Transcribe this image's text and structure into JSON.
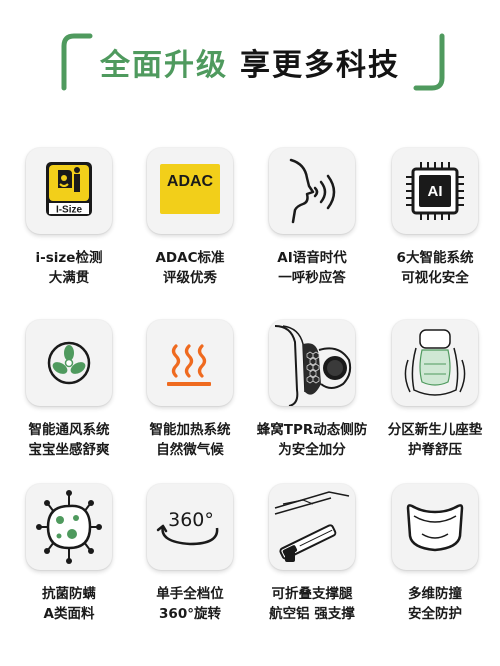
{
  "header": {
    "title_green": "全面升级",
    "title_dark": "享更多科技"
  },
  "colors": {
    "accent_green": "#4f9a5e",
    "badge_yellow": "#f2cf1a",
    "heat_orange": "#ef6a1f",
    "tile_bg": "#f3f3f3"
  },
  "features": [
    {
      "icon": "isize-badge-icon",
      "badge_text": "I-Size",
      "line1": "i-size检测",
      "line2": "大满贯"
    },
    {
      "icon": "adac-badge-icon",
      "badge_text": "ADAC",
      "line1": "ADAC标准",
      "line2": "评级优秀"
    },
    {
      "icon": "voice-head-icon",
      "line1": "AI语音时代",
      "line2": "一呼秒应答"
    },
    {
      "icon": "ai-chip-icon",
      "badge_text": "AI",
      "line1": "6大智能系统",
      "line2": "可视化安全"
    },
    {
      "icon": "fan-icon",
      "line1": "智能通风系统",
      "line2": "宝宝坐感舒爽"
    },
    {
      "icon": "heat-waves-icon",
      "line1": "智能加热系统",
      "line2": "自然微气候"
    },
    {
      "icon": "honeycomb-side-icon",
      "line1": "蜂窝TPR动态侧防",
      "line2": "为安全加分"
    },
    {
      "icon": "newborn-seat-icon",
      "line1": "分区新生儿座垫",
      "line2": "护脊舒压"
    },
    {
      "icon": "germ-icon",
      "line1": "抗菌防螨",
      "line2": "A类面料"
    },
    {
      "icon": "rotate-360-icon",
      "badge_text": "360°",
      "line1": "单手全档位",
      "line2": "360°旋转"
    },
    {
      "icon": "support-leg-icon",
      "line1": "可折叠支撑腿",
      "line2": "航空铝 强支撑"
    },
    {
      "icon": "impact-shield-icon",
      "line1": "多维防撞",
      "line2": "安全防护"
    }
  ]
}
